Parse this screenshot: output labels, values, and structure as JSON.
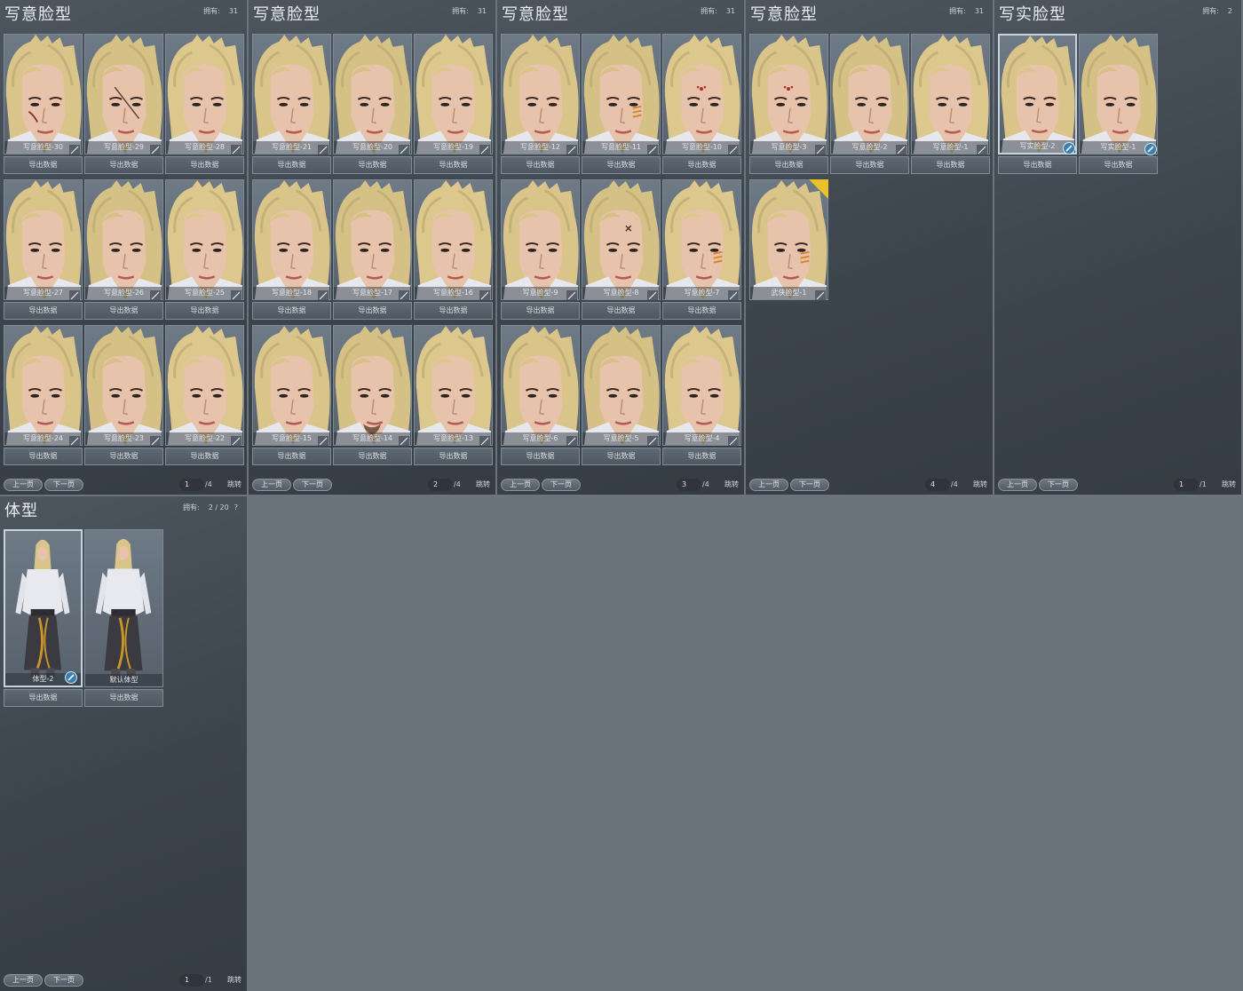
{
  "face_panels": [
    {
      "title": "写意脸型",
      "owned_label": "拥有:",
      "owned_value": "31",
      "cards": [
        {
          "label": "写意脸型-30",
          "hair": "#d9c489",
          "mark": "scar"
        },
        {
          "label": "写意脸型-29",
          "hair": "#d5c085",
          "mark": "scar2"
        },
        {
          "label": "写意脸型-28",
          "hair": "#dcc78d",
          "mark": ""
        },
        {
          "label": "写意脸型-27",
          "hair": "#d9c489",
          "mark": ""
        },
        {
          "label": "写意脸型-26",
          "hair": "#d5c085",
          "mark": ""
        },
        {
          "label": "写意脸型-25",
          "hair": "#dcc78d",
          "mark": ""
        },
        {
          "label": "写意脸型-24",
          "hair": "#d9c489",
          "mark": ""
        },
        {
          "label": "写意脸型-23",
          "hair": "#d5c085",
          "mark": ""
        },
        {
          "label": "写意脸型-22",
          "hair": "#dcc78d",
          "mark": ""
        }
      ],
      "export_label": "导出数据",
      "prev_label": "上一页",
      "next_label": "下一页",
      "page": "1",
      "page_total": "/4",
      "jump_label": "跳转"
    },
    {
      "title": "写意脸型",
      "owned_label": "拥有:",
      "owned_value": "31",
      "cards": [
        {
          "label": "写意脸型-21",
          "hair": "#d9c489",
          "mark": ""
        },
        {
          "label": "写意脸型-20",
          "hair": "#d5c085",
          "mark": ""
        },
        {
          "label": "写意脸型-19",
          "hair": "#dcc78d",
          "mark": ""
        },
        {
          "label": "写意脸型-18",
          "hair": "#d9c489",
          "mark": ""
        },
        {
          "label": "写意脸型-17",
          "hair": "#d5c085",
          "mark": ""
        },
        {
          "label": "写意脸型-16",
          "hair": "#dcc78d",
          "mark": ""
        },
        {
          "label": "写意脸型-15",
          "hair": "#d9c489",
          "mark": ""
        },
        {
          "label": "写意脸型-14",
          "hair": "#d5c085",
          "mark": "beard"
        },
        {
          "label": "写意脸型-13",
          "hair": "#dcc78d",
          "mark": ""
        }
      ],
      "export_label": "导出数据",
      "prev_label": "上一页",
      "next_label": "下一页",
      "page": "2",
      "page_total": "/4",
      "jump_label": "跳转"
    },
    {
      "title": "写意脸型",
      "owned_label": "拥有:",
      "owned_value": "31",
      "cards": [
        {
          "label": "写意脸型-12",
          "hair": "#d9c489",
          "mark": ""
        },
        {
          "label": "写意脸型-11",
          "hair": "#d5c085",
          "mark": "paint"
        },
        {
          "label": "写意脸型-10",
          "hair": "#dcc78d",
          "mark": "dots"
        },
        {
          "label": "写意脸型-9",
          "hair": "#d9c489",
          "mark": ""
        },
        {
          "label": "写意脸型-8",
          "hair": "#d5c085",
          "mark": "cross"
        },
        {
          "label": "写意脸型-7",
          "hair": "#dcc78d",
          "mark": "paint"
        },
        {
          "label": "写意脸型-6",
          "hair": "#d9c489",
          "mark": ""
        },
        {
          "label": "写意脸型-5",
          "hair": "#d5c085",
          "mark": ""
        },
        {
          "label": "写意脸型-4",
          "hair": "#dcc78d",
          "mark": ""
        }
      ],
      "export_label": "导出数据",
      "prev_label": "上一页",
      "next_label": "下一页",
      "page": "3",
      "page_total": "/4",
      "jump_label": "跳转"
    },
    {
      "title": "写意脸型",
      "owned_label": "拥有:",
      "owned_value": "31",
      "cards": [
        {
          "label": "写意脸型-3",
          "hair": "#d9c489",
          "mark": "dots"
        },
        {
          "label": "写意脸型-2",
          "hair": "#d5c085",
          "mark": ""
        },
        {
          "label": "写意脸型-1",
          "hair": "#dcc78d",
          "mark": ""
        },
        {
          "label": "武侠脸型-1",
          "hair": "#d9c489",
          "mark": "paint",
          "badge": true,
          "no_export": true
        }
      ],
      "export_label": "导出数据",
      "prev_label": "上一页",
      "next_label": "下一页",
      "page": "4",
      "page_total": "/4",
      "jump_label": "跳转"
    },
    {
      "title": "写实脸型",
      "owned_label": "拥有:",
      "owned_value": "2",
      "cards": [
        {
          "label": "写实脸型-2",
          "hair": "#d9c489",
          "mark": "",
          "selected": true,
          "in_use": true
        },
        {
          "label": "写实脸型-1",
          "hair": "#d5c085",
          "mark": "",
          "in_use": true
        }
      ],
      "export_label": "导出数据",
      "prev_label": "上一页",
      "next_label": "下一页",
      "page": "1",
      "page_total": "/1",
      "jump_label": "跳转"
    }
  ],
  "body_panel": {
    "title": "体型",
    "owned_label": "拥有:",
    "owned_value": "2 / 20",
    "help_icon": "?",
    "cards": [
      {
        "label": "体型-2",
        "selected": true,
        "in_use": true
      },
      {
        "label": "默认体型"
      }
    ],
    "export_label": "导出数据",
    "prev_label": "上一页",
    "next_label": "下一页",
    "page": "1",
    "page_total": "/1",
    "jump_label": "跳转"
  },
  "colors": {
    "skin": "#e8c3ab",
    "hair_shade": "#b9a36a",
    "check_blue": "#4aa8d8",
    "badge_yellow": "#e9c22a"
  }
}
